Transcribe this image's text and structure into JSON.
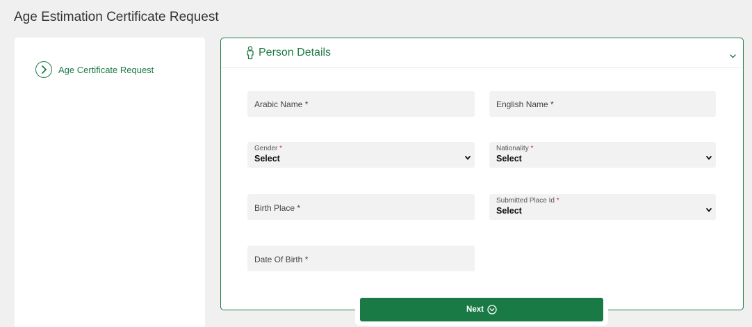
{
  "page": {
    "title": "Age Estimation Certificate Request"
  },
  "sidebar": {
    "items": [
      {
        "label": "Age Certificate Request",
        "icon": "chevron-right-circle-icon"
      }
    ]
  },
  "section": {
    "title": "Person Details",
    "icon": "person-icon",
    "collapse_icon": "chevron-down-icon"
  },
  "form": {
    "arabic_name": {
      "label": "Arabic Name *",
      "value": ""
    },
    "english_name": {
      "label": "English Name *",
      "value": ""
    },
    "gender": {
      "label": "Gender",
      "required": "*",
      "value": "Select"
    },
    "nationality": {
      "label": "Nationality",
      "required": "*",
      "value": "Select"
    },
    "birth_place": {
      "label": "Birth Place *",
      "value": ""
    },
    "submitted_place": {
      "label": "Submitted Place Id",
      "required": "*",
      "value": "Select"
    },
    "date_of_birth": {
      "label": "Date Of Birth *",
      "value": ""
    }
  },
  "actions": {
    "next_label": "Next",
    "next_icon": "chevron-down-circle-icon"
  },
  "colors": {
    "accent": "#1d7a45",
    "required": "#c0392b",
    "background": "#f0f0f0",
    "field": "#f2f2f2"
  }
}
